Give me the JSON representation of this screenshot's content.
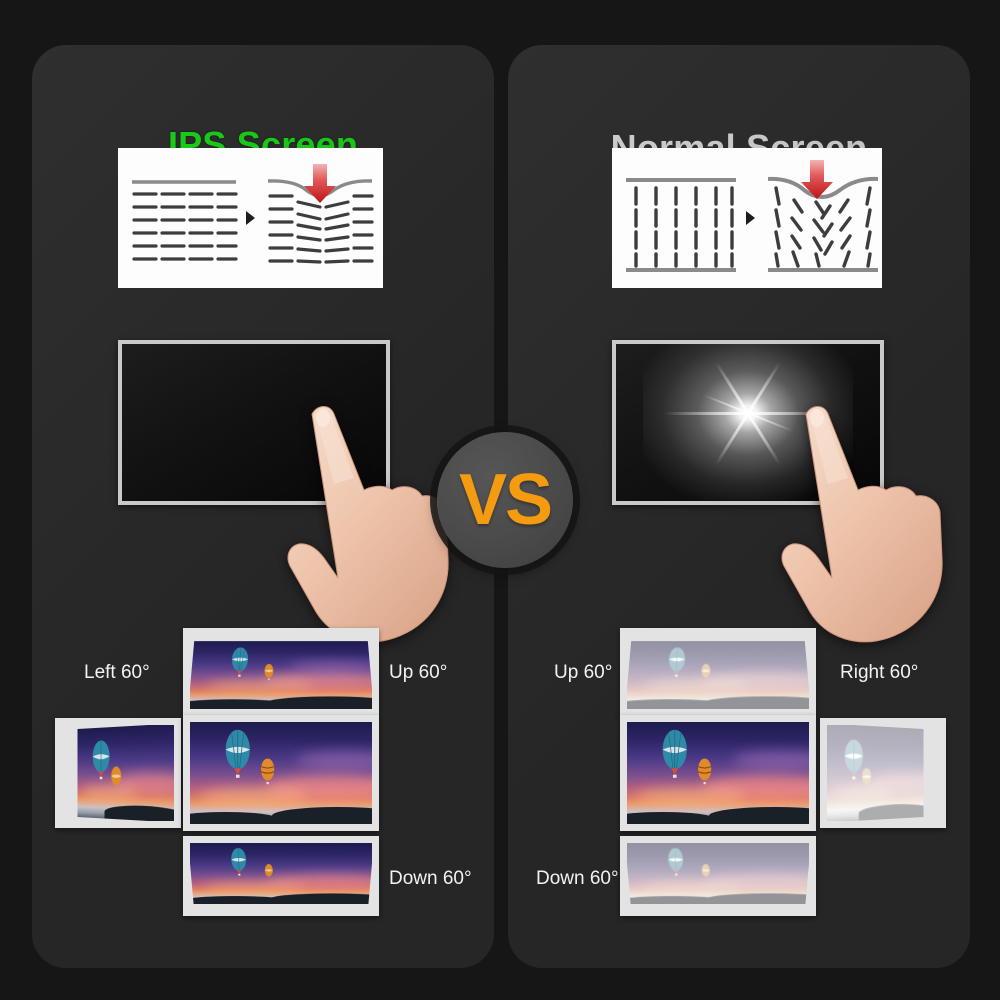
{
  "background_color": "#161616",
  "card_color": "#2a2a2a",
  "panels": {
    "left": {
      "title": "IPS Screen",
      "title_color": "#16CF16",
      "pressure_diagram": {
        "before_state": "horizontal-aligned-crystals",
        "after_state": "horizontal-crystals-slight-dip",
        "arrow_color": "#D9252B"
      },
      "touch_demo": {
        "screen_state": "uniform-black-no-ripple"
      },
      "viewing_angles": {
        "left": "Left 60°",
        "up": "Up 60°",
        "down": "Down 60°",
        "image_quality": "vivid-at-all-angles"
      }
    },
    "right": {
      "title": "Normal Screen",
      "title_color": "#CFCFCF",
      "pressure_diagram": {
        "before_state": "vertical-aligned-crystals",
        "after_state": "vertical-crystals-scattered",
        "arrow_color": "#D9252B"
      },
      "touch_demo": {
        "screen_state": "white-starburst-bloom"
      },
      "viewing_angles": {
        "up": "Up 60°",
        "right": "Right 60°",
        "down": "Down 60°",
        "image_quality": "washed-out-at-angles"
      }
    }
  },
  "versus": {
    "label": "VS",
    "text_color": "#F59B11",
    "circle_color": "#4a4a4a"
  },
  "icons": {
    "pressure_arrow": "down-arrow-icon",
    "transition_marker": "play-triangle-icon",
    "pointing_hand": "pointing-hand-icon"
  }
}
